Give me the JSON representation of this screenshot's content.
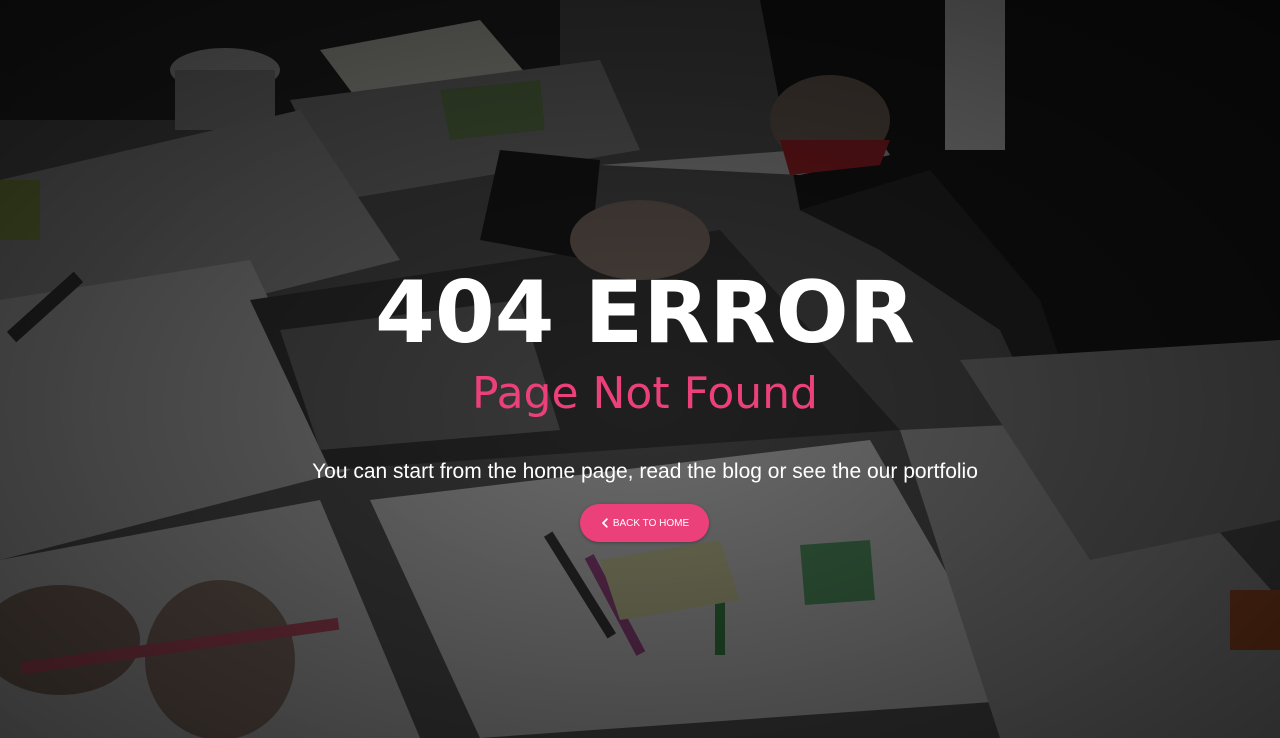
{
  "error": {
    "title": "404 ERROR",
    "subtitle": "Page Not Found",
    "message": "You can start from the home page, read the blog or see the our portfolio"
  },
  "actions": {
    "back_label": "BACK TO HOME",
    "back_icon": "chevron-left-icon"
  },
  "colors": {
    "accent": "#ec407a",
    "text": "#ffffff",
    "overlay": "rgba(0,0,0,0.48)"
  }
}
